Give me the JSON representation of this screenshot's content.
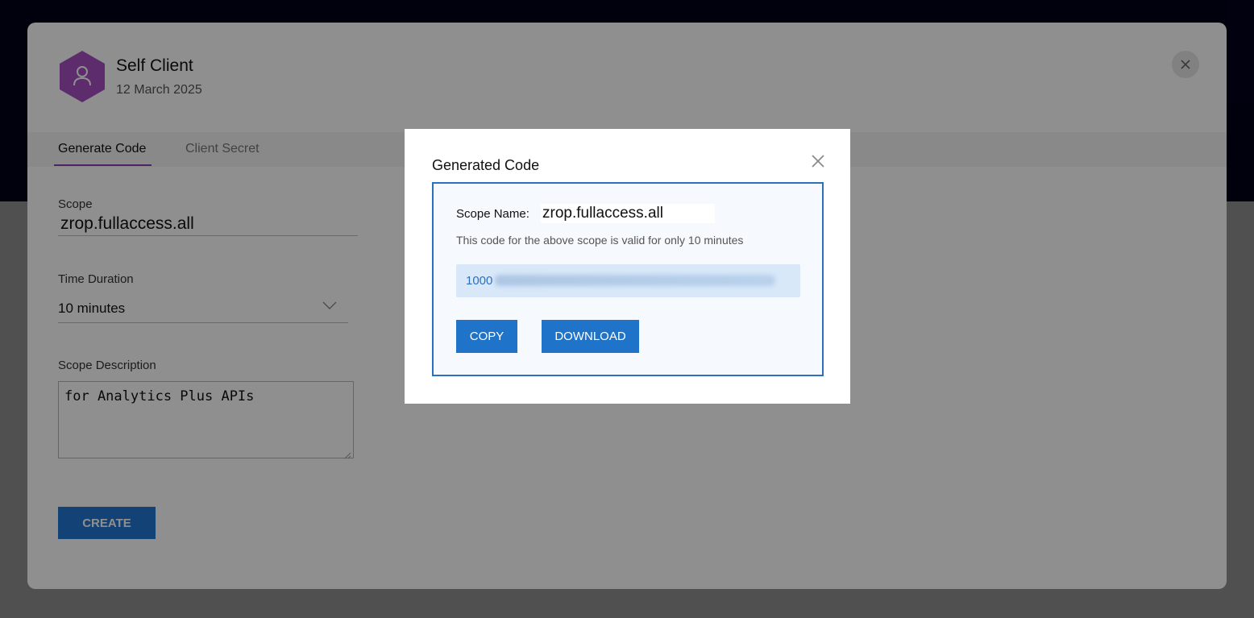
{
  "client": {
    "name": "Self Client",
    "date": "12 March 2025"
  },
  "tabs": [
    {
      "label": "Generate Code",
      "active": true
    },
    {
      "label": "Client Secret",
      "active": false
    }
  ],
  "form": {
    "scope_label": "Scope",
    "scope_value": "zrop.fullaccess.all",
    "duration_label": "Time Duration",
    "duration_value": "10 minutes",
    "description_label": "Scope Description",
    "description_value": "for Analytics Plus APIs",
    "create_label": "CREATE"
  },
  "modal": {
    "title": "Generated Code",
    "scope_name_label": "Scope Name:",
    "scope_name_value": "zrop.fullaccess.all",
    "validity_text": "This code for the above scope is valid for only 10 minutes",
    "code_prefix": "1000",
    "copy_label": "COPY",
    "download_label": "DOWNLOAD"
  },
  "colors": {
    "accent": "#2377d3",
    "tab_underline": "#8f3eb8",
    "avatar": "#a64fc0",
    "header_band": "#03021a"
  },
  "icons": {
    "avatar": "user-icon",
    "card_close": "close-icon",
    "modal_close": "close-icon",
    "duration_dropdown": "chevron-down-icon"
  }
}
